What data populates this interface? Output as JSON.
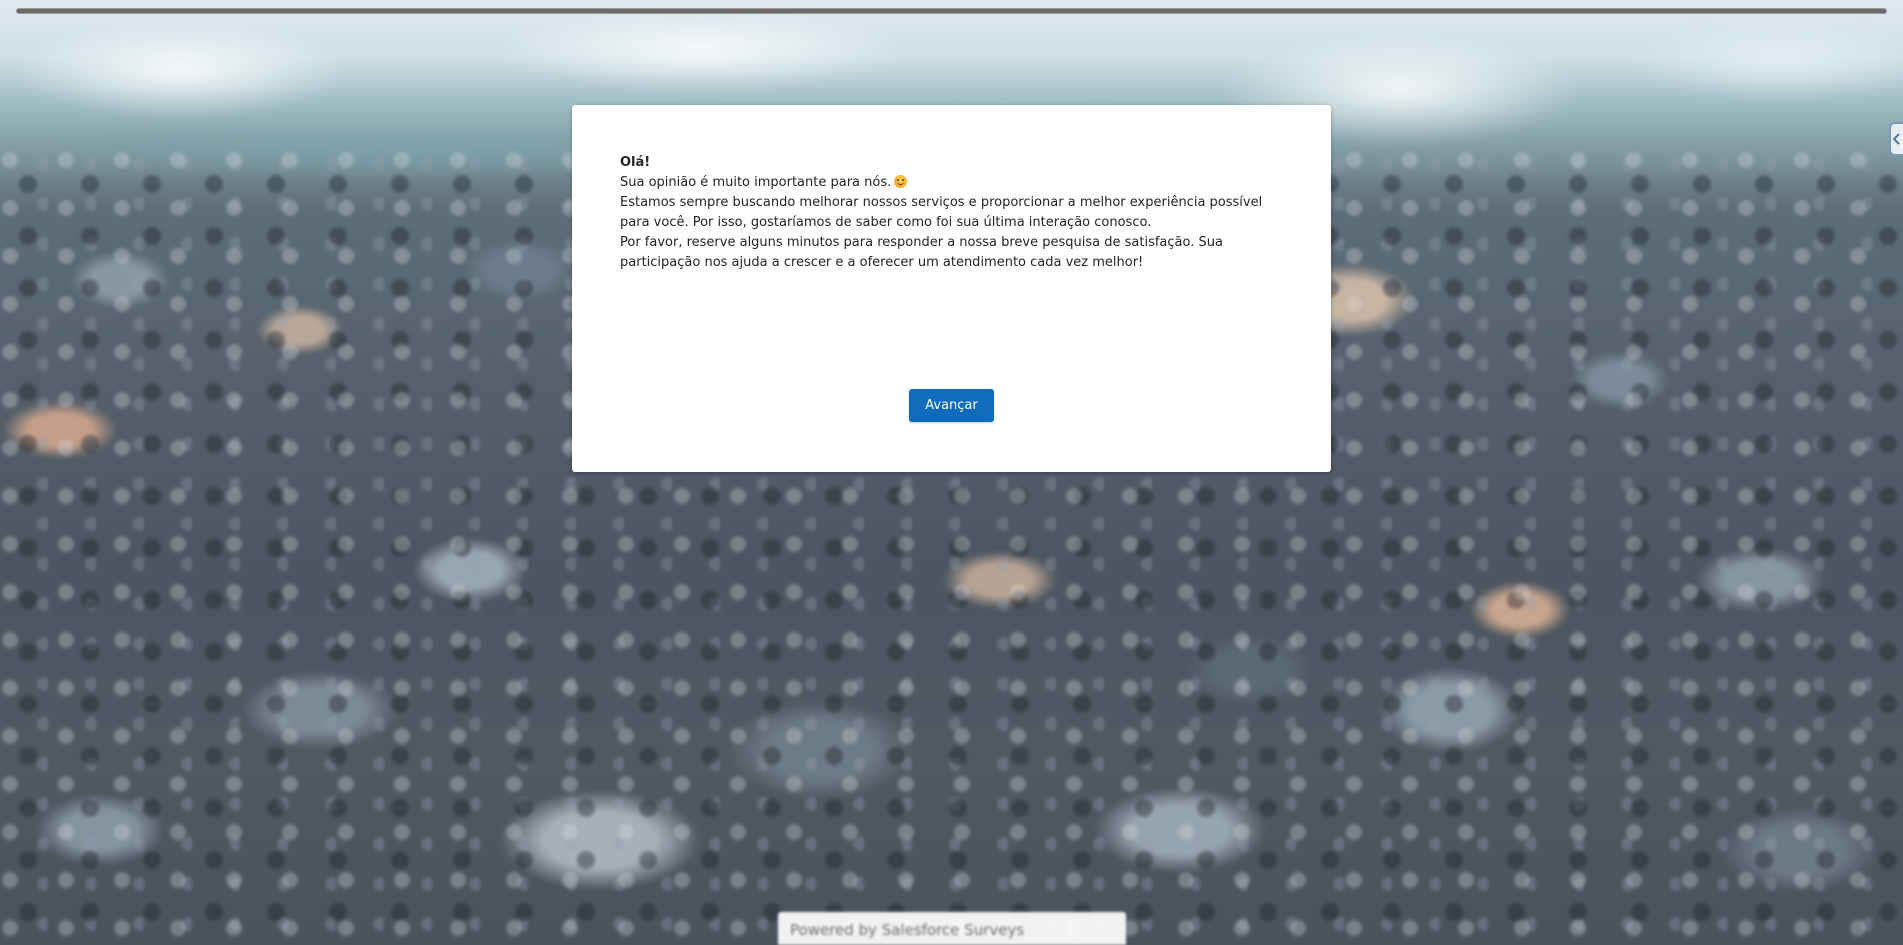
{
  "progress": {
    "percent": 100
  },
  "dialog": {
    "greeting": "Olá!",
    "line1": "Sua opinião é muito importante para nós.",
    "line1_emoji": "smiling-face",
    "line2": "Estamos sempre buscando melhorar nossos serviços e proporcionar a melhor experiência possível para você. Por isso, gostaríamos de saber como foi sua última interação conosco.",
    "line3": "Por favor, reserve alguns minutos para responder a nossa breve pesquisa de satisfação. Sua participação nos ajuda a crescer e a oferecer um atendimento cada vez melhor!",
    "next_button": "Avançar"
  },
  "footer": {
    "powered_by": "Powered by Salesforce Surveys"
  },
  "colors": {
    "primary_button": "#0f6cbd",
    "card_background": "#ffffff",
    "text": "#252423"
  }
}
